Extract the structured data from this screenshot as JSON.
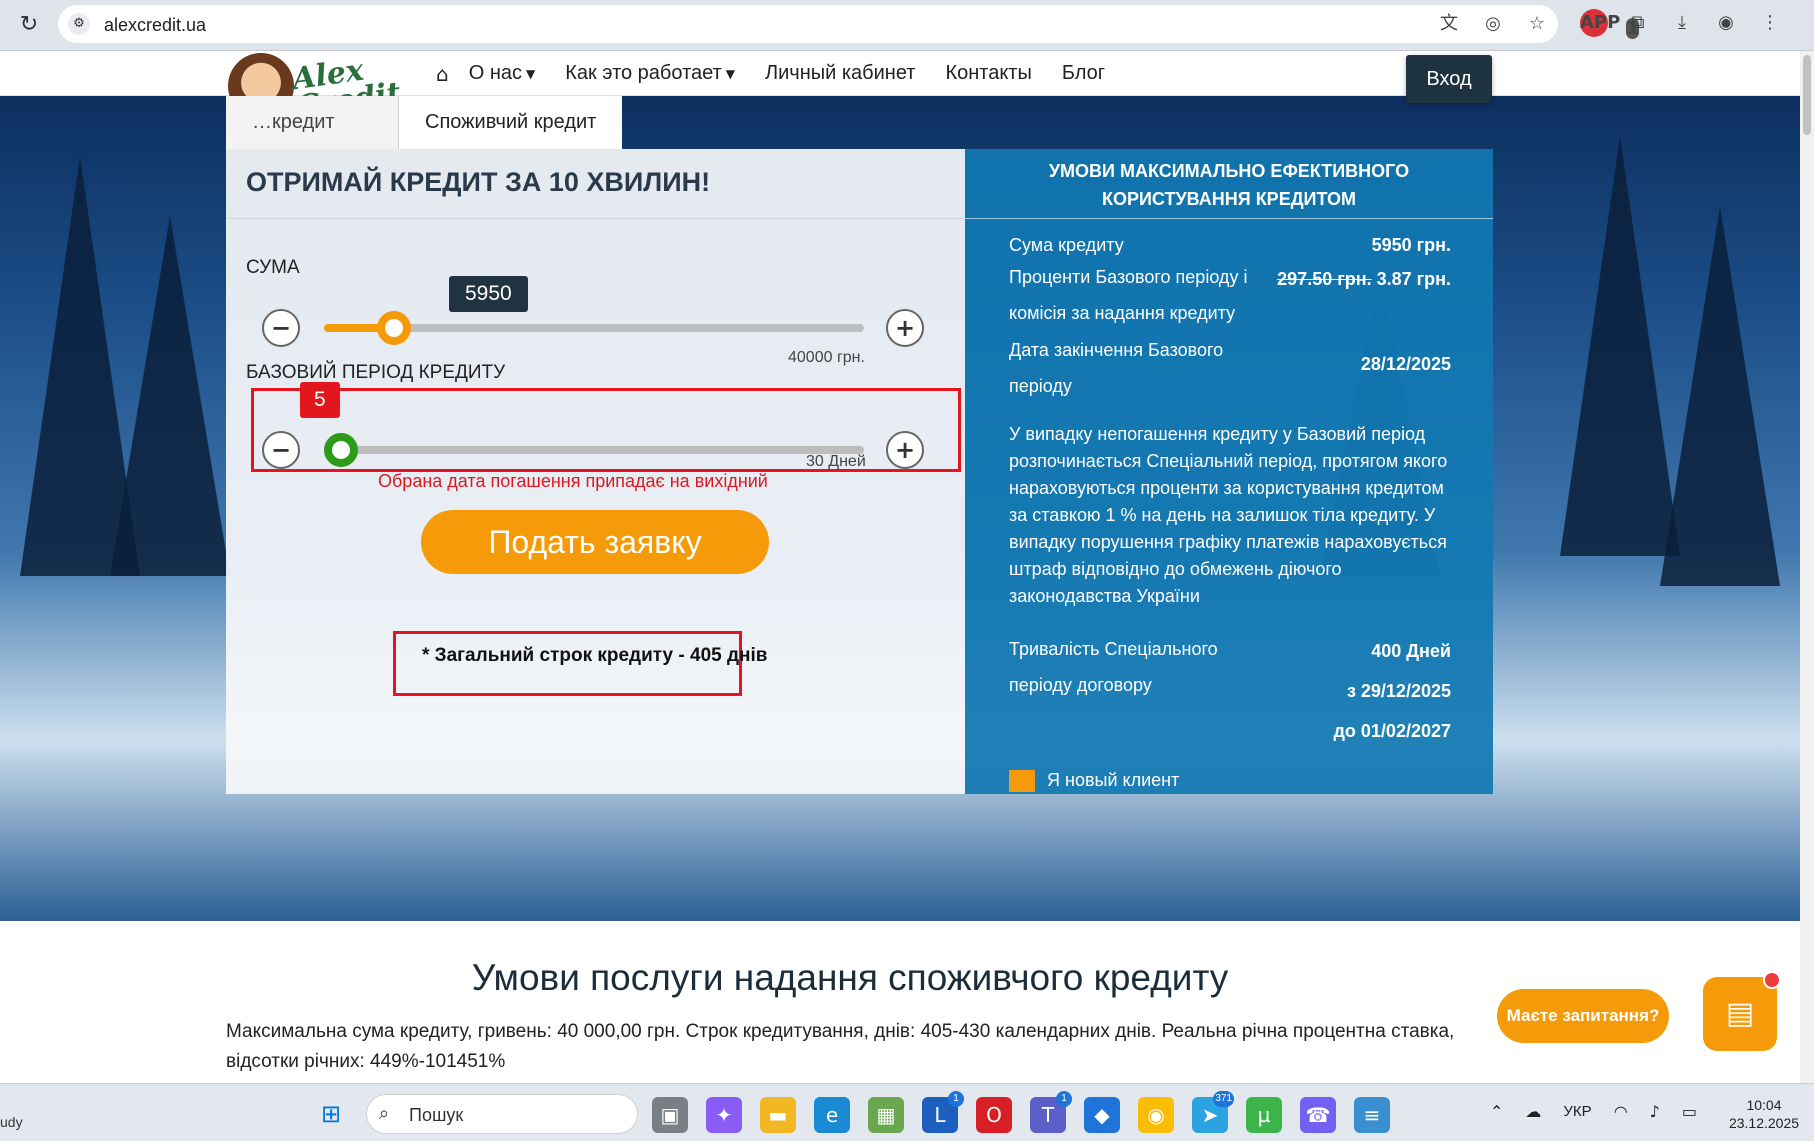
{
  "browser": {
    "url": "alexcredit.ua",
    "reload_icon": "reload-icon",
    "ext_badge": "APP",
    "ext_count": "1"
  },
  "nav": {
    "logo_text": "Alex Credit",
    "items": [
      "О нас",
      "Как это работает",
      "Личный кабинет",
      "Контакты",
      "Блог"
    ],
    "login": "Вход"
  },
  "tabs": {
    "inactive": "…кредит",
    "active": "Споживчий кредит"
  },
  "calculator": {
    "title": "ОТРИМАЙ КРЕДИТ ЗА 10 ХВИЛИН!",
    "amount_label": "СУМА",
    "amount_value": "5950",
    "amount_level": 0.13,
    "amount_max": "40000 грн.",
    "period_label": "БАЗОВИЙ ПЕРІОД КРЕДИТУ",
    "period_value": "5",
    "period_level": 0.0,
    "period_max": "30 Дней",
    "warning": "Обрана дата погашення припадає на вихідний",
    "apply_button": "Подать заявку",
    "total_term": "* Загальний строк кредиту - 405 днів"
  },
  "info_panel": {
    "title_line1": "УМОВИ МАКСИМАЛЬНО ЕФЕКТИВНОГО",
    "title_line2": "КОРИСТУВАННЯ КРЕДИТОМ",
    "sum_label": "Сума кредиту",
    "sum_value": "5950 грн.",
    "interest_label_1": "Проценти Базового періоду і",
    "interest_label_2": "комісія за надання кредиту",
    "interest_old": "297.50 грн.",
    "interest_new": "3.87 грн.",
    "end_date_label_1": "Дата закінчення Базового",
    "end_date_label_2": "періоду",
    "end_date_value": "28/12/2025",
    "paragraph": "У випадку непогашення кредиту у Базовий період розпочинається Спеціальний період, протягом якого нараховуються проценти за користування кредитом за ставкою 1 % на день на залишок тіла кредиту. У випадку порушення графіку платежів нараховується штраф відповідно до обмежень діючого законодавства України",
    "special_label_1": "Тривалість Спеціального",
    "special_label_2": "періоду договору",
    "special_days": "400 Дней",
    "special_from": "з 29/12/2025",
    "special_to": "до 01/02/2027",
    "new_client": "Я новый клиент"
  },
  "lower": {
    "title": "Умови послуги надання споживчого кредиту",
    "description": "Максимальна сума кредиту, гривень: 40 000,00 грн. Строк кредитування, днів: 405-430 календарних днів. Реальна річна процентна ставка, відсотки річних: 449%-101451%"
  },
  "chat": {
    "bubble": "Маєте запитання?"
  },
  "taskbar": {
    "left_text": "udy",
    "search_placeholder": "Пошук",
    "lang": "УКР",
    "time": "10:04",
    "date": "23.12.2025",
    "badge_l": "1",
    "badge_teams": "1",
    "badge_telegram": "371"
  },
  "colors": {
    "accent": "#f59b0a",
    "panel_blue": "#1178b2",
    "period_green": "#2e9a1a",
    "warn_red": "#e2161c"
  }
}
